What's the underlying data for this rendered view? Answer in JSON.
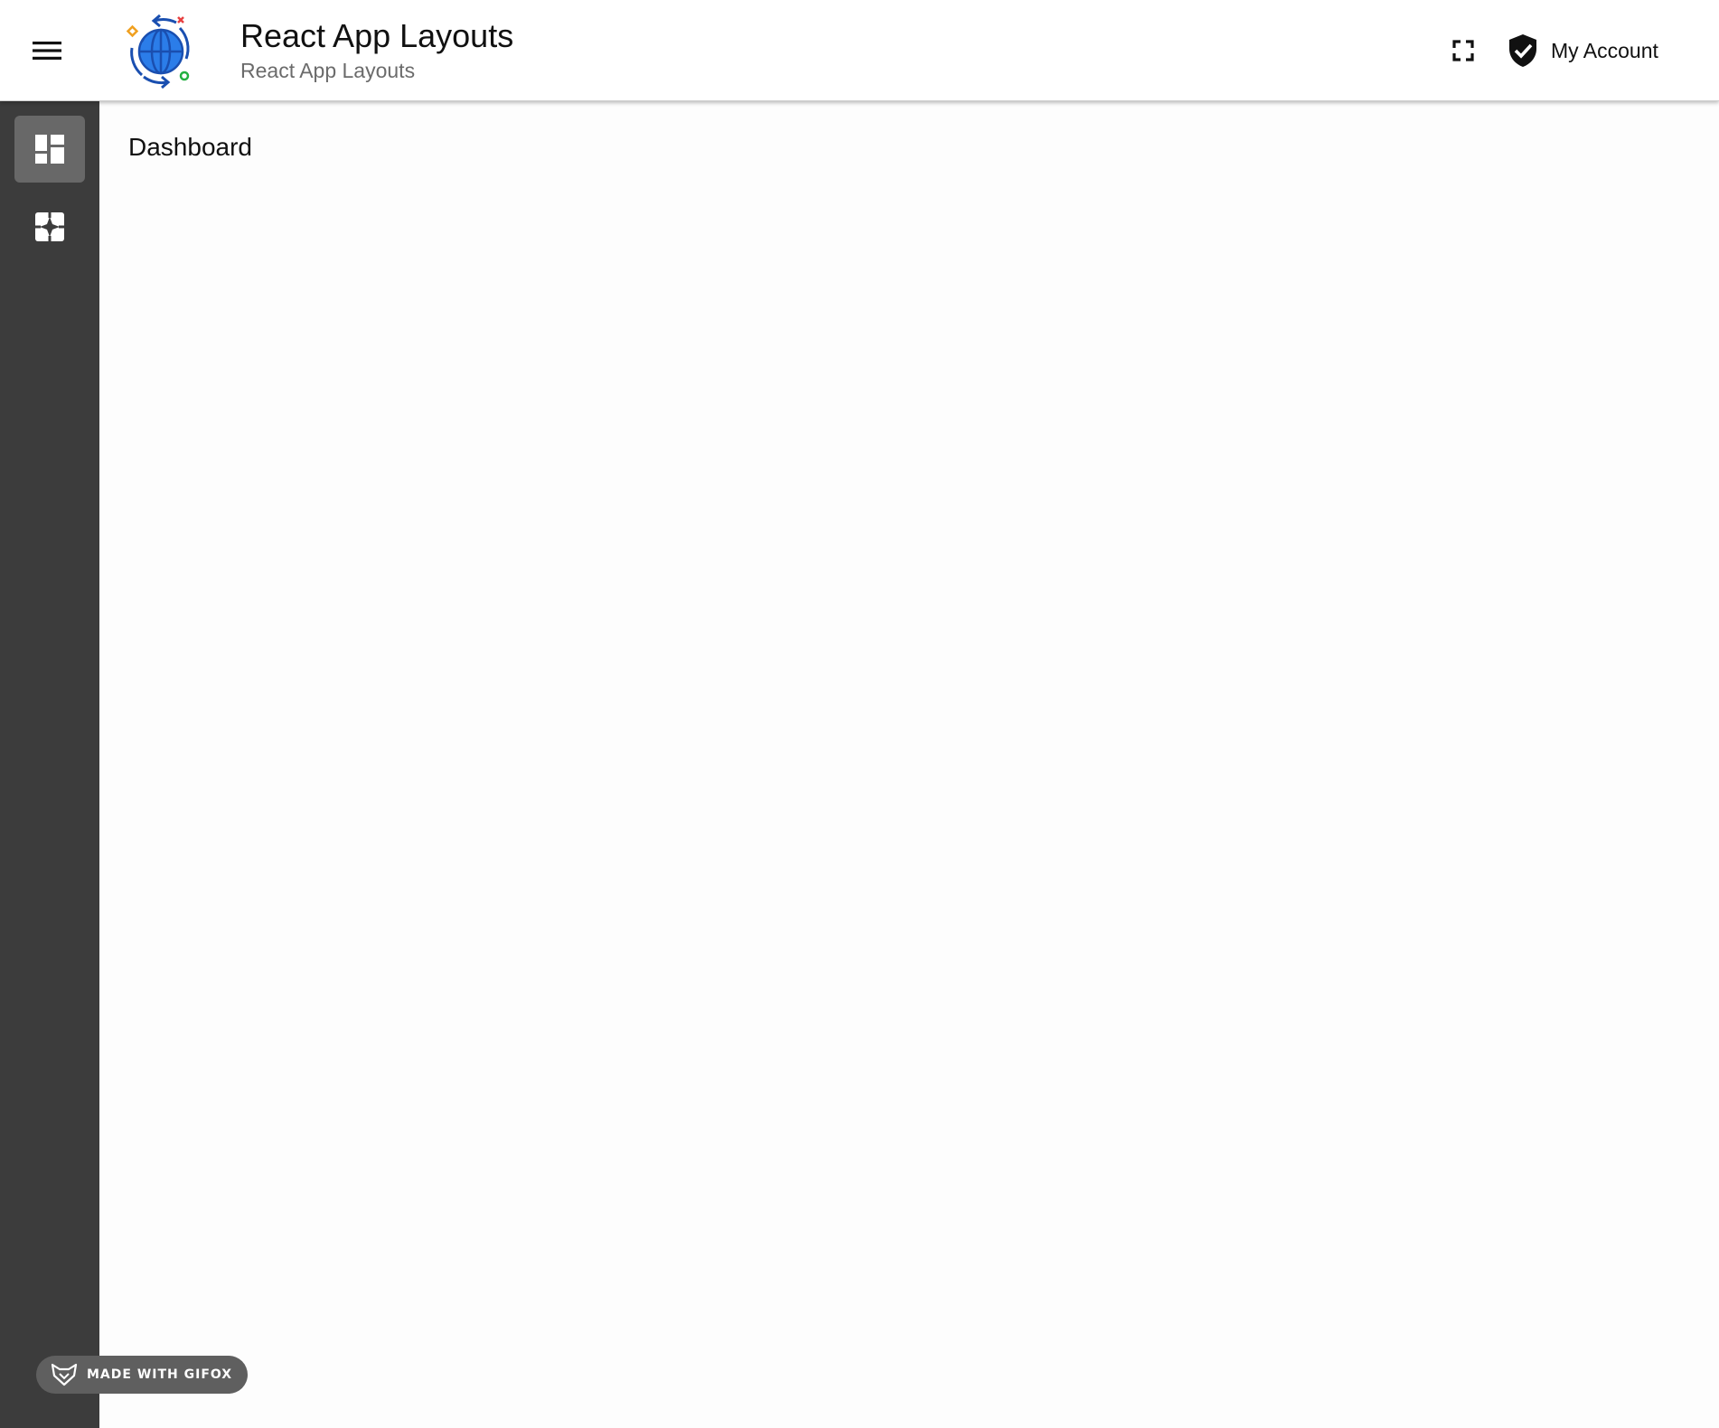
{
  "app_bar": {
    "title": "React App Layouts",
    "subtitle": "React App Layouts",
    "menu_icon": "hamburger-menu-icon",
    "logo_icon": "globe-sync-logo",
    "fullscreen_icon": "fullscreen-icon",
    "account_icon": "verified-shield-icon",
    "account_label": "My Account"
  },
  "sidebar": {
    "items": [
      {
        "icon": "dashboard-icon",
        "active": true
      },
      {
        "icon": "widgets-icon",
        "active": false
      }
    ]
  },
  "main": {
    "page_title": "Dashboard"
  },
  "watermark": {
    "icon": "gifox-fox-icon",
    "label": "MADE WITH GIFOX"
  },
  "colors": {
    "sidebar_bg": "#3c3c3c",
    "sidebar_active": "#686868",
    "logo_blue": "#2b7de9",
    "watermark_bg": "#5f5f5f"
  }
}
